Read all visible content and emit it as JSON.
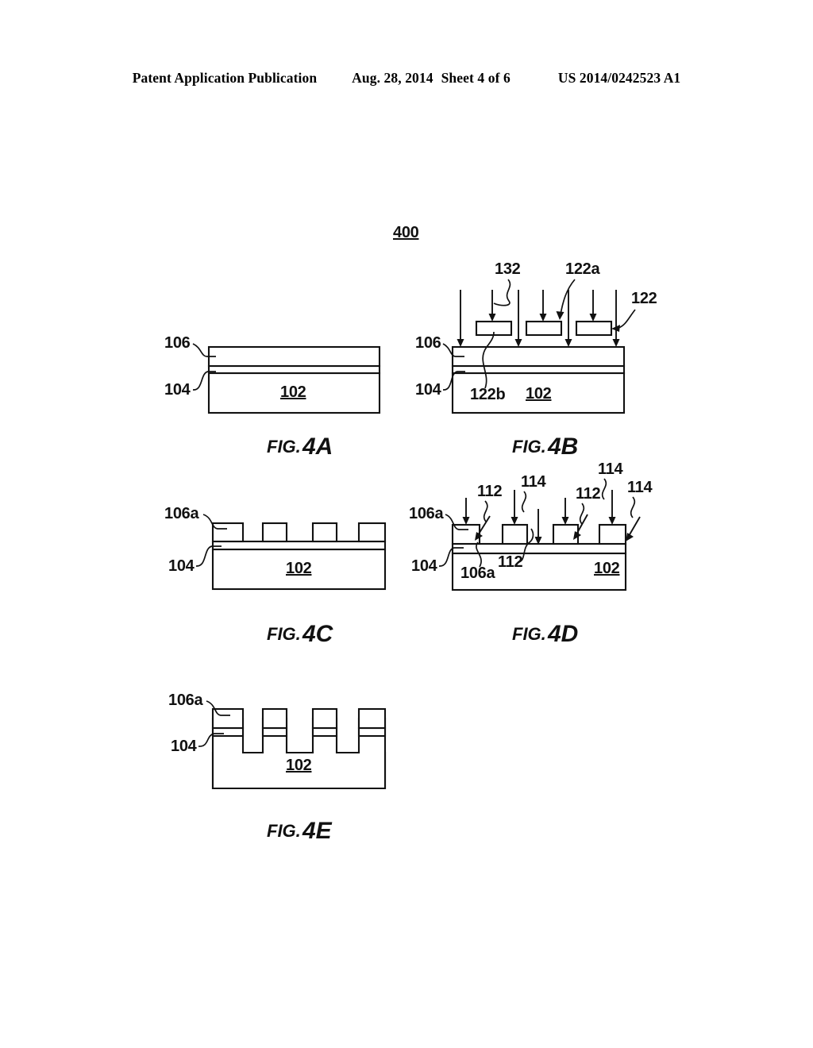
{
  "header": {
    "publication": "Patent Application Publication",
    "date": "Aug. 28, 2014",
    "sheet": "Sheet 4 of 6",
    "patent_number": "US 2014/0242523 A1"
  },
  "drawing": {
    "sheet_label": "400",
    "figures": [
      {
        "id": "fig-4a",
        "caption_prefix": "FIG.",
        "caption_number": "4A",
        "substrate_label": "102",
        "left_labels": [
          "106",
          "104"
        ]
      },
      {
        "id": "fig-4b",
        "caption_prefix": "FIG.",
        "caption_number": "4B",
        "substrate_label": "102",
        "left_labels": [
          "106",
          "104"
        ],
        "top_labels": [
          "132",
          "122a",
          "122"
        ],
        "inner_label": "122b"
      },
      {
        "id": "fig-4c",
        "caption_prefix": "FIG.",
        "caption_number": "4C",
        "substrate_label": "102",
        "left_labels": [
          "106a",
          "104"
        ]
      },
      {
        "id": "fig-4d",
        "caption_prefix": "FIG.",
        "caption_number": "4D",
        "substrate_label": "102",
        "left_labels": [
          "106a",
          "104"
        ],
        "callouts": [
          "112",
          "114",
          "114",
          "112",
          "114",
          "106a",
          "112"
        ]
      },
      {
        "id": "fig-4e",
        "caption_prefix": "FIG.",
        "caption_number": "4E",
        "substrate_label": "102",
        "left_labels": [
          "106a",
          "104"
        ]
      }
    ],
    "labels": {
      "n102": "102",
      "n104": "104",
      "n106": "106",
      "n106a": "106a",
      "n112": "112",
      "n114": "114",
      "n122": "122",
      "n122a": "122a",
      "n122b": "122b",
      "n132": "132",
      "n400": "400",
      "fig_prefix": "FIG.",
      "fig_4a": "4A",
      "fig_4b": "4B",
      "fig_4c": "4C",
      "fig_4d": "4D",
      "fig_4e": "4E"
    }
  },
  "colors": {
    "ink": "#111111",
    "paper": "#ffffff"
  }
}
